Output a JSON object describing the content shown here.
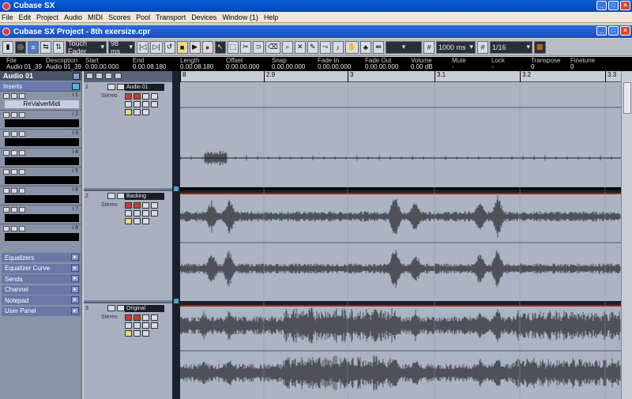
{
  "app_title": "Cubase SX",
  "menu": [
    "File",
    "Edit",
    "Project",
    "Audio",
    "MIDI",
    "Scores",
    "Pool",
    "Transport",
    "Devices",
    "Window (1)",
    "Help"
  ],
  "project_title": "Cubase SX Project - 8th exersize.cpr",
  "toolbar": {
    "automation_mode": "Touch Fader",
    "ms_value": "98 ms",
    "nudge_value": "1000 ms",
    "quantize": "1/16"
  },
  "infoline": {
    "headers": [
      "File",
      "Description",
      "Start",
      "End",
      "Length",
      "Offset",
      "Snap",
      "Fade In",
      "Fade Out",
      "Volume",
      "Mute",
      "Lock",
      "Transpose",
      "Finetune"
    ],
    "values": [
      "Audio 01_39",
      "Audio 01_39",
      "0.00.00.000",
      "0.00.08.180",
      "0.00.08.180",
      "0.00.00.000",
      "0.00.00.000",
      "0.00.00.000",
      "0.00.00.000",
      "0.00 dB",
      "-",
      "-",
      "0",
      "0"
    ]
  },
  "inspector": {
    "track_name": "Audio 01",
    "inserts_label": "Inserts",
    "slots": [
      {
        "num": "i 1",
        "name": "ReValverMidi"
      },
      {
        "num": "i 2",
        "name": ""
      },
      {
        "num": "i 3",
        "name": ""
      },
      {
        "num": "i 4",
        "name": ""
      },
      {
        "num": "i 5",
        "name": ""
      },
      {
        "num": "i 6",
        "name": ""
      },
      {
        "num": "i 7",
        "name": ""
      },
      {
        "num": "i 8",
        "name": ""
      }
    ],
    "sections": [
      "Equalizers",
      "Equalizer Curve",
      "Sends",
      "Channel",
      "Notepad",
      "User Panel"
    ]
  },
  "tracks": [
    {
      "num": "1",
      "name": "Audio 01",
      "type": "Stereo"
    },
    {
      "num": "2",
      "name": "Backing",
      "type": "Stereo"
    },
    {
      "num": "3",
      "name": "Original",
      "type": "Stereo"
    }
  ],
  "ruler": [
    "8",
    "2.9",
    "3",
    "3.1",
    "3.2",
    "3.3"
  ]
}
